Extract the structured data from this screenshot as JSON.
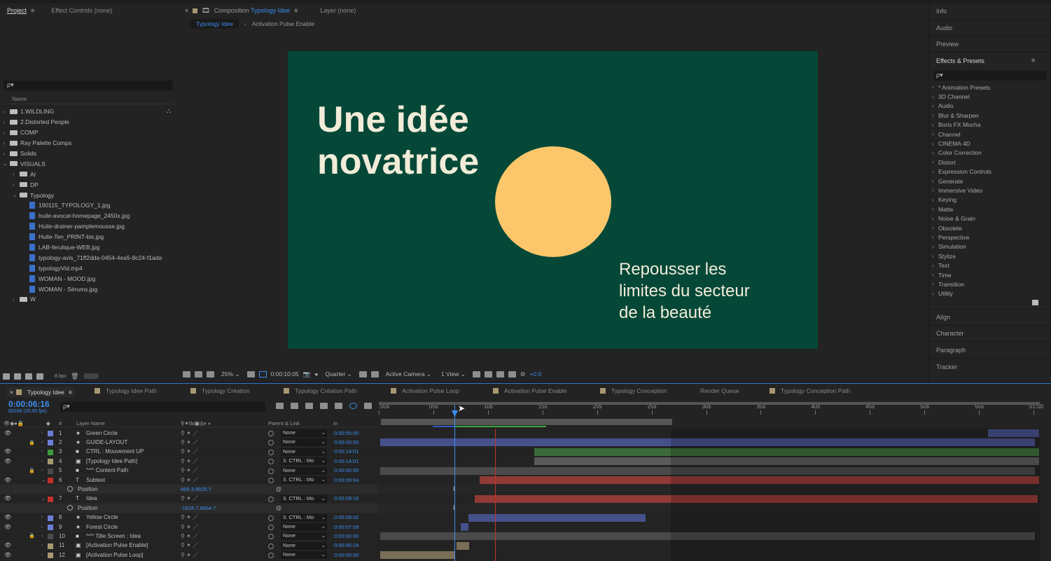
{
  "project_panel": {
    "tabs": [
      "Project",
      "Effect Controls (none)"
    ],
    "search_placeholder": "ρ▾",
    "column_name": "Name",
    "tree": [
      {
        "label": "1.WILDLING",
        "type": "folder",
        "depth": 0,
        "expanded": false
      },
      {
        "label": "2.Distorted People",
        "type": "folder",
        "depth": 0,
        "expanded": false
      },
      {
        "label": "COMP",
        "type": "folder",
        "depth": 0,
        "expanded": false
      },
      {
        "label": "Ray Palette Comps",
        "type": "folder",
        "depth": 0,
        "expanded": false
      },
      {
        "label": "Solids",
        "type": "folder",
        "depth": 0,
        "expanded": false
      },
      {
        "label": "VISUALS",
        "type": "folder",
        "depth": 0,
        "expanded": true
      },
      {
        "label": "AI",
        "type": "folder",
        "depth": 1,
        "expanded": false
      },
      {
        "label": "DP",
        "type": "folder",
        "depth": 1,
        "expanded": false
      },
      {
        "label": "Typology",
        "type": "folder",
        "depth": 1,
        "expanded": true
      },
      {
        "label": "190115_TYPOLOGY_1.jpg",
        "type": "file",
        "depth": 2
      },
      {
        "label": "huile-avocat-homepage_2450x.jpg",
        "type": "file",
        "depth": 2
      },
      {
        "label": "Huile-drainer-pamplemousse.jpg",
        "type": "file",
        "depth": 2
      },
      {
        "label": "Huile-Ten_PRINT-bis.jpg",
        "type": "file",
        "depth": 2
      },
      {
        "label": "LAB-ferulique-WEB.jpg",
        "type": "file",
        "depth": 2
      },
      {
        "label": "typology-avis_71ff2dda-0454-4ea5-8c24-f1ada",
        "type": "file",
        "depth": 2
      },
      {
        "label": "typologyVid.mp4",
        "type": "file",
        "depth": 2
      },
      {
        "label": "WOMAN - MOOD.jpg",
        "type": "file",
        "depth": 2
      },
      {
        "label": "WOMAN - Sérums.jpg",
        "type": "file",
        "depth": 2
      },
      {
        "label": "W",
        "type": "folder",
        "depth": 1,
        "expanded": false
      }
    ],
    "bpc": "8 bpc"
  },
  "viewer": {
    "tab_composition_prefix": "Composition",
    "tab_composition_name": "Typology Idee",
    "tab_layer": "Layer (none)",
    "subtabs": [
      "Typology Idee",
      "Activation Pulse Enable"
    ],
    "headline_line1": "Une idée",
    "headline_line2": "novatrice",
    "sub_line1": "Repousser les",
    "sub_line2": "limites du secteur",
    "sub_line3": "de la beauté",
    "bg_color": "#064838",
    "circle_color": "#fcc76a",
    "toolbar": {
      "zoom": "25%",
      "timecode": "0:00:10:05",
      "resolution": "Quarter",
      "camera": "Active Camera",
      "views": "1 View",
      "exposure": "+0.0"
    }
  },
  "right_panel": {
    "sections": [
      "Info",
      "Audio",
      "Preview",
      "Effects & Presets"
    ],
    "effects_search": "ρ▾",
    "effects": [
      "* Animation Presets",
      "3D Channel",
      "Audio",
      "Blur & Sharpen",
      "Boris FX Mocha",
      "Channel",
      "CINEMA 4D",
      "Color Correction",
      "Distort",
      "Expression Controls",
      "Generate",
      "Immersive Video",
      "Keying",
      "Matte",
      "Noise & Grain",
      "Obsolete",
      "Perspective",
      "Simulation",
      "Stylize",
      "Text",
      "Time",
      "Transition",
      "Utility"
    ],
    "lower_sections": [
      "Align",
      "Character",
      "Paragraph",
      "Tracker"
    ]
  },
  "timeline": {
    "tabs": [
      "Typology Idee",
      "Typology Idee Path",
      "Typology Création",
      "Typology Création Path",
      "Activation Pulse Loop",
      "Activation Pulse Enable",
      "Typology Conception",
      "Render Queue",
      "Typology Conception Path"
    ],
    "timecode": "0:00:06:16",
    "fps": "00166 (25.00 fps)",
    "search_placeholder": "ρ▾",
    "col_layer_name": "Layer Name",
    "col_parent": "Parent & Link",
    "col_in": "In",
    "ruler": [
      ":00s",
      "05s",
      "10s",
      "15s",
      "20s",
      "25s",
      "30s",
      "35s",
      "40s",
      "45s",
      "50s",
      "55s",
      "01:00"
    ],
    "rows": [
      {
        "kind": "layer",
        "num": "1",
        "name": "Green Circle",
        "label_color": "#6a7fd6",
        "parent": "None",
        "in": "0:00:55:00",
        "locked": false,
        "bar_start": 0.922,
        "bar_end": 0.999,
        "bar_color": "#46508a",
        "type": "star"
      },
      {
        "kind": "layer",
        "num": "2",
        "name": "GUIDE-LAYOUT",
        "label_color": "#6a7fd6",
        "parent": "None",
        "in": "0:00:00:00",
        "locked": true,
        "bar_start": 0.002,
        "bar_end": 0.993,
        "bar_color": "#46508a",
        "type": "star"
      },
      {
        "kind": "layer",
        "num": "3",
        "name": "CTRL : Mouvement UP",
        "label_color": "#3e9a3a",
        "parent": "None",
        "in": "0:00:14:01",
        "locked": false,
        "bar_start": 0.235,
        "bar_end": 0.999,
        "bar_color": "#3c6b3a",
        "type": "solid"
      },
      {
        "kind": "layer",
        "num": "4",
        "name": "[Typology Idee Path]",
        "label_color": "#a89872",
        "parent": "3. CTRL : Mo",
        "in": "0:00:14:01",
        "locked": false,
        "bar_start": 0.235,
        "bar_end": 0.999,
        "bar_color": "#5a5a5a",
        "type": "comp"
      },
      {
        "kind": "layer",
        "num": "5",
        "name": "^^^ Content Path",
        "label_color": "#4a4a4a",
        "parent": "None",
        "in": "0:00:00:00",
        "locked": true,
        "bar_start": 0.002,
        "bar_end": 0.993,
        "bar_color": "#4a4a4a",
        "type": "solid"
      },
      {
        "kind": "layer",
        "num": "6",
        "name": "Subtext",
        "label_color": "#c4302b",
        "parent": "3. CTRL : Mo",
        "in": "0:00:09:04",
        "locked": false,
        "expanded": true,
        "bar_start": 0.153,
        "bar_end": 0.999,
        "bar_color": "#923a36",
        "type": "text"
      },
      {
        "kind": "prop",
        "name": "Position",
        "value": "669.3,9825.7"
      },
      {
        "kind": "layer",
        "num": "7",
        "name": "Idea",
        "label_color": "#c4302b",
        "parent": "3. CTRL : Mo",
        "in": "0:00:08:16",
        "locked": false,
        "expanded": true,
        "bar_start": 0.145,
        "bar_end": 0.997,
        "bar_color": "#923a36",
        "type": "text"
      },
      {
        "kind": "prop",
        "name": "Position",
        "value": "-1634.7,8664.7"
      },
      {
        "kind": "layer",
        "num": "8",
        "name": "Yellow Circle",
        "label_color": "#6a7fd6",
        "parent": "3. CTRL : Mo",
        "in": "0:00:08:02",
        "locked": false,
        "bar_start": 0.136,
        "bar_end": 0.404,
        "bar_color": "#46508a",
        "type": "star"
      },
      {
        "kind": "layer",
        "num": "9",
        "name": "Forest Circle",
        "label_color": "#6a7fd6",
        "parent": "None",
        "in": "0:00:07:09",
        "locked": false,
        "bar_start": 0.124,
        "bar_end": 0.136,
        "bar_color": "#46508a",
        "type": "star"
      },
      {
        "kind": "layer",
        "num": "10",
        "name": "^^^ Title Screen : Idea",
        "label_color": "#4a4a4a",
        "parent": "None",
        "in": "0:00:00:00",
        "locked": true,
        "bar_start": 0.002,
        "bar_end": 0.993,
        "bar_color": "#4a4a4a",
        "type": "solid"
      },
      {
        "kind": "layer",
        "num": "11",
        "name": "[Activation Pulse Enable]",
        "label_color": "#a89872",
        "parent": "None",
        "in": "0:00:06:24",
        "locked": false,
        "bar_start": 0.118,
        "bar_end": 0.137,
        "bar_color": "#7a6e58",
        "type": "comp"
      },
      {
        "kind": "layer",
        "num": "12",
        "name": "[Activation Pulse Loop]",
        "label_color": "#a89872",
        "parent": "None",
        "in": "0:00:00:00",
        "locked": false,
        "bar_start": 0.002,
        "bar_end": 0.116,
        "bar_color": "#7a6e58",
        "type": "comp"
      }
    ]
  }
}
